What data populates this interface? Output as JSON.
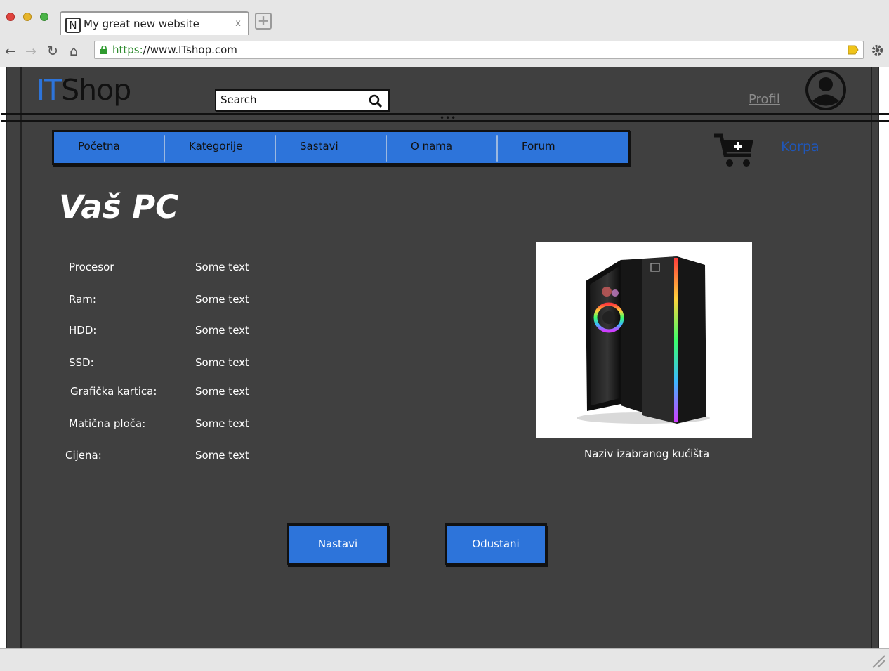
{
  "browser": {
    "tab_favicon": "N",
    "tab_title": "My great new website",
    "tab_close": "x",
    "url_protocol": "https:",
    "url_rest": "//www.ITshop.com"
  },
  "header": {
    "logo_it": "IT",
    "logo_shop": "Shop",
    "search_placeholder": "Search",
    "profile_label": "Profil"
  },
  "nav": {
    "items": [
      {
        "label": "Početna"
      },
      {
        "label": "Kategorije"
      },
      {
        "label": "Sastavi"
      },
      {
        "label": "O nama"
      },
      {
        "label": "Forum"
      }
    ],
    "cart_label": "Korpa"
  },
  "main": {
    "title": "Vaš PC",
    "specs": [
      {
        "label": "Procesor",
        "value": "Some text"
      },
      {
        "label": "Ram:",
        "value": "Some text"
      },
      {
        "label": "HDD:",
        "value": "Some text"
      },
      {
        "label": "SSD:",
        "value": "Some text"
      },
      {
        "label": "Grafička kartica:",
        "value": "Some text"
      },
      {
        "label": "Matična ploča:",
        "value": "Some text"
      },
      {
        "label": "Cijena:",
        "value": "Some text"
      }
    ],
    "case_caption": "Naziv izabranog kućišta",
    "continue_label": "Nastavi",
    "cancel_label": "Odustani"
  },
  "colors": {
    "accent": "#2d74da",
    "page_bg": "#404040",
    "link_gray": "#8a8a8a",
    "cart_link": "#1f56b8"
  },
  "icons": [
    "lock-icon",
    "bookmark-icon",
    "gear-icon",
    "search-icon",
    "avatar-icon",
    "cart-add-icon",
    "resize-icon"
  ]
}
